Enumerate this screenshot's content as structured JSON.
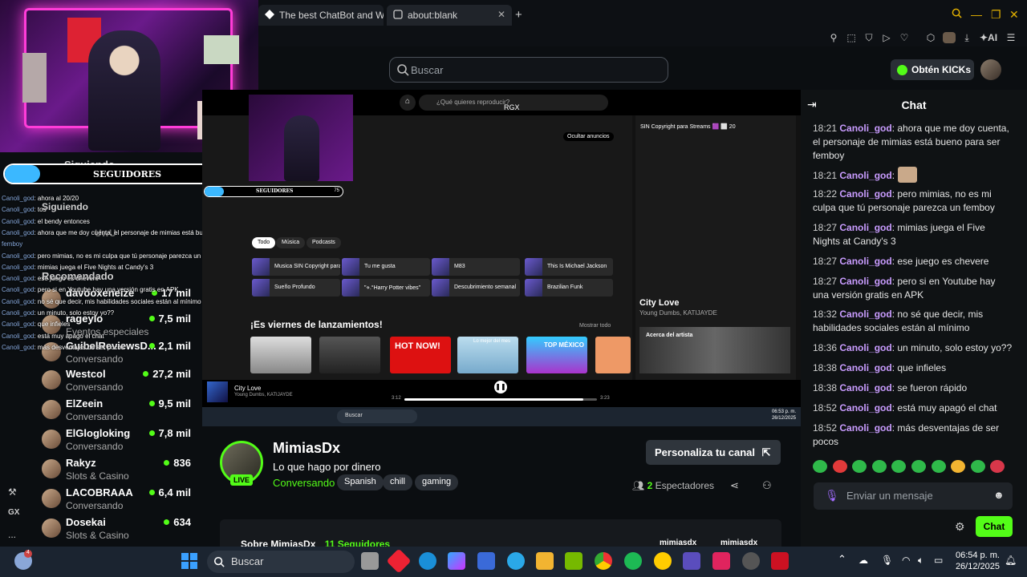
{
  "browser": {
    "tabs": [
      {
        "label": "The best ChatBot and Wi"
      },
      {
        "label": "about:blank"
      }
    ],
    "ai_label": "AI"
  },
  "header": {
    "search_placeholder": "Buscar",
    "kicks_label": "Obtén KICKs"
  },
  "overlay": {
    "follow_count": "75",
    "follow_label": "SEGUIDORES",
    "follow_progress": 0.15,
    "chat": [
      {
        "user": "Canoli_god",
        "text": ": ahora al 20/20"
      },
      {
        "user": "Canoli_god",
        "text": ": tos"
      },
      {
        "user": "Canoli_god",
        "text": ": el bendy entonces"
      },
      {
        "user": "Canoli_god",
        "text": ": ahora que me doy cuenta, el personaje de mimias está bueno para ser"
      },
      {
        "user": "femboy",
        "text": ""
      },
      {
        "user": "Canoli_god",
        "text": ": pero mimias, no es mi culpa que tú personaje parezca un femboy"
      },
      {
        "user": "Canoli_god",
        "text": ": mimias juega el Five Nights at Candy's 3"
      },
      {
        "user": "Canoli_god",
        "text": ": ese juego es chevere"
      },
      {
        "user": "Canoli_god",
        "text": ": pero si en Youtube hay una versión gratis en APK"
      },
      {
        "user": "Canoli_god",
        "text": ": no sé que decir, mis habilidades sociales están al mínimo"
      },
      {
        "user": "Canoli_god",
        "text": ": un minuto, solo estoy yo??"
      },
      {
        "user": "Canoli_god",
        "text": ": que infieles"
      },
      {
        "user": "Canoli_god",
        "text": ": está muy apagó el chat"
      },
      {
        "user": "Canoli_god",
        "text": ": más desventajas de ser pocos"
      }
    ]
  },
  "sidebar": {
    "following_title": "Siguiendo",
    "following_title_2": "Siguiendo",
    "uwu": "UwU",
    "recommended_title": "Recomendado",
    "recommended": [
      {
        "name": "davooxeneize",
        "category": "",
        "viewers": "17 mil"
      },
      {
        "name": "rageylo",
        "category": "Eventos especiales",
        "viewers": "7,5 mil"
      },
      {
        "name": "GuibelReviewsD...",
        "category": "Conversando",
        "viewers": "2,1 mil"
      },
      {
        "name": "Westcol",
        "category": "Conversando",
        "viewers": "27,2 mil"
      },
      {
        "name": "ElZeein",
        "category": "Conversando",
        "viewers": "9,5 mil"
      },
      {
        "name": "ElGlogloking",
        "category": "Conversando",
        "viewers": "7,8 mil"
      },
      {
        "name": "Rakyz",
        "category": "Slots & Casino",
        "viewers": "836"
      },
      {
        "name": "LACOBRAAA",
        "category": "Conversando",
        "viewers": "6,4 mil"
      },
      {
        "name": "Dosekai",
        "category": "Slots & Casino",
        "viewers": "634"
      }
    ],
    "rail": [
      "GX",
      "..."
    ]
  },
  "video": {
    "spotify": {
      "search_placeholder": "¿Qué quieres reproducir?",
      "rgx": "RGX",
      "hide_ads": "Ocultar anuncios",
      "right_title": "SIN Copyright para Streams 🟪 ⬜ 20",
      "chips": [
        "Todo",
        "Música",
        "Podcasts"
      ],
      "cards": [
        {
          "label": "Musica SIN Copyright para..."
        },
        {
          "label": "Tu me gusta"
        },
        {
          "label": "M83"
        },
        {
          "label": "This Is Michael Jackson"
        },
        {
          "label": "Sueño Profundo"
        },
        {
          "label": "\"⋄.°Harry Potter vibes\""
        },
        {
          "label": "Descubrimiento semanal"
        },
        {
          "label": "Brazilian Funk"
        }
      ],
      "section_title": "¡Es viernes de lanzamientos!",
      "show_all": "Mostrar todo",
      "tile_labels": [
        "HOT NOW!",
        "Lo mejor del mes",
        "TOP MÉXICO"
      ],
      "now_playing": {
        "title": "City Love",
        "artist": "Young Dumbs, KATIJAYDE",
        "elapsed": "3:12",
        "total": "3:23",
        "progress": 0.93
      },
      "about_artist": "Acerca del artista",
      "taskbar_search": "Buscar",
      "clock_time": "06:53 p. m.",
      "clock_date": "26/12/2025"
    },
    "mini_follow_label": "SEGUIDORES",
    "mini_follow_count": "75"
  },
  "channel": {
    "name": "MimiasDx",
    "title": "Lo que hago por dinero",
    "category": "Conversando",
    "tags": [
      "Spanish",
      "chill",
      "gaming"
    ],
    "live": "LIVE",
    "customize_label": "Personaliza tu canal",
    "viewers_count": "2",
    "viewers_label": "Espectadores",
    "about": "Sobre MimiasDx",
    "followers": "11 Seguidores",
    "social_1": "mimiasdx",
    "social_2": "mimiasdx"
  },
  "chat": {
    "title": "Chat",
    "messages": [
      {
        "time": "18:21",
        "user": "Canoli_god",
        "text": ": ahora que me doy cuenta, el personaje de mimias está bueno para ser femboy"
      },
      {
        "time": "18:21",
        "user": "Canoli_god",
        "text": ":"
      },
      {
        "time": "18:22",
        "user": "Canoli_god",
        "text": ": pero mimias, no es mi culpa que tú personaje parezca un femboy"
      },
      {
        "time": "18:27",
        "user": "Canoli_god",
        "text": ": mimias juega el Five Nights at Candy's 3"
      },
      {
        "time": "18:27",
        "user": "Canoli_god",
        "text": ": ese juego es chevere"
      },
      {
        "time": "18:27",
        "user": "Canoli_god",
        "text": ": pero si en Youtube hay una versión gratis en APK"
      },
      {
        "time": "18:32",
        "user": "Canoli_god",
        "text": ": no sé que decir, mis habilidades sociales están al mínimo"
      },
      {
        "time": "18:36",
        "user": "Canoli_god",
        "text": ": un minuto, solo estoy yo??"
      },
      {
        "time": "18:38",
        "user": "Canoli_god",
        "text": ": que infieles"
      },
      {
        "time": "18:38",
        "user": "Canoli_god",
        "text": ": se fueron rápido"
      },
      {
        "time": "18:52",
        "user": "Canoli_god",
        "text": ": está muy apagó el chat"
      },
      {
        "time": "18:52",
        "user": "Canoli_god",
        "text": ": más desventajas de ser pocos"
      }
    ],
    "input_placeholder": "Enviar un mensaje",
    "send_label": "Chat"
  },
  "taskbar": {
    "search_label": "Buscar",
    "time": "06:54 p. m.",
    "date": "26/12/2025",
    "notification_count": "4"
  },
  "colors": {
    "kick_green": "#53fc18",
    "chat_user": "#c99cff"
  }
}
